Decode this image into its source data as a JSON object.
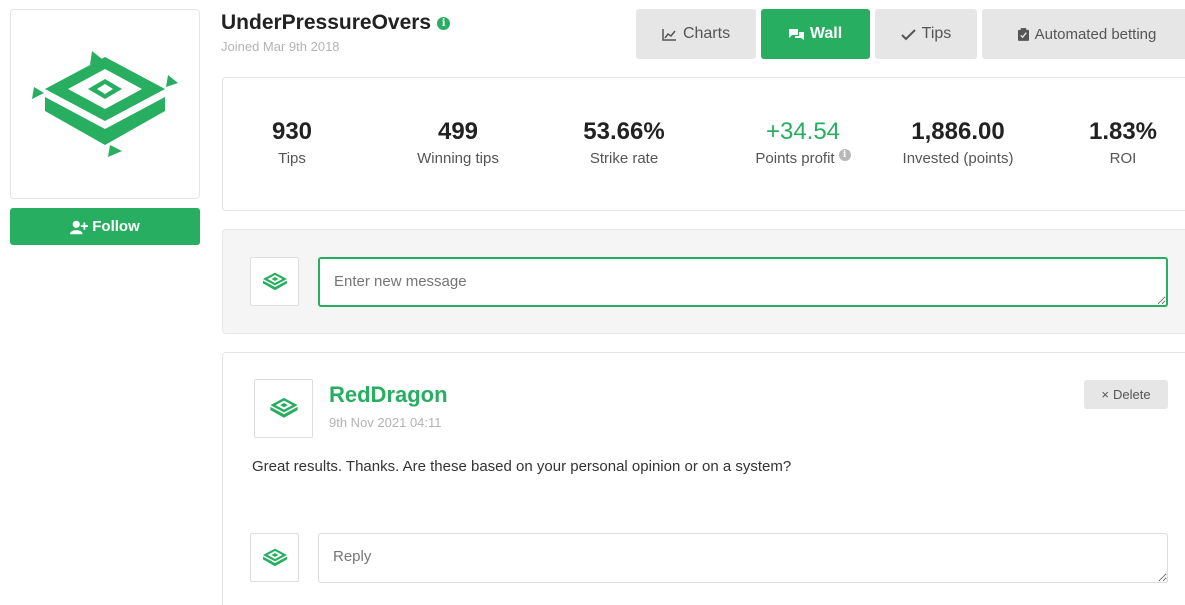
{
  "profile": {
    "username": "UnderPressureOvers",
    "joined": "Joined Mar 9th 2018",
    "follow_label": "Follow"
  },
  "tabs": [
    {
      "label": "Charts",
      "icon": "line-chart-icon",
      "active": false
    },
    {
      "label": "Wall",
      "icon": "chat-bubbles-icon",
      "active": true
    },
    {
      "label": "Tips",
      "icon": "checkmark-icon",
      "active": false
    },
    {
      "label": "Automated betting",
      "icon": "clipboard-icon",
      "active": false
    }
  ],
  "stats": [
    {
      "value": "930",
      "label": "Tips"
    },
    {
      "value": "499",
      "label": "Winning tips"
    },
    {
      "value": "53.66%",
      "label": "Strike rate"
    },
    {
      "value": "+34.54",
      "label": "Points profit"
    },
    {
      "value": "1,886.00",
      "label": "Invested (points)"
    },
    {
      "value": "1.83%",
      "label": "ROI"
    }
  ],
  "compose": {
    "placeholder": "Enter new message"
  },
  "post": {
    "author": "RedDragon",
    "date": "9th Nov 2021 04:11",
    "delete_label": "Delete",
    "text": "Great results. Thanks. Are these based on your personal opinion or on a system?",
    "reply_placeholder": "Reply"
  },
  "colors": {
    "accent": "#27ae60",
    "tab_inactive": "#e6e6e6"
  }
}
